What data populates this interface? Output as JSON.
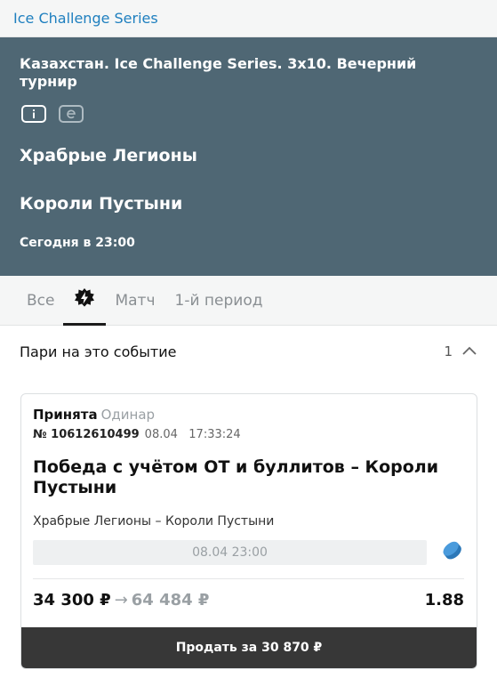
{
  "topbar": {
    "title": "Ice Challenge Series"
  },
  "event": {
    "tournament": "Казахстан. Ice Challenge Series. 3x10. Вечерний турнир",
    "team1": "Храбрые Легионы",
    "team2": "Короли Пустыни",
    "time": "Сегодня в 23:00",
    "icons": [
      "info-icon",
      "e-icon"
    ]
  },
  "tabs": [
    {
      "label": "Все",
      "active": false
    },
    {
      "icon": "flash-icon",
      "active": true
    },
    {
      "label": "Матч",
      "active": false
    },
    {
      "label": "1-й период",
      "active": false
    }
  ],
  "section": {
    "title": "Пари на это событие",
    "count": "1"
  },
  "bet": {
    "status": "Принята",
    "type": "Одинар",
    "number": "№ 10612610499",
    "datetime": "08.04   17:33:24",
    "title": "Победа с учётом ОТ и буллитов – Короли Пустыни",
    "teams": "Храбрые Легионы – Короли Пустыни",
    "event_time": "08.04 23:00",
    "stake": "34 300 ₽",
    "arrow": "→",
    "payout": "64 484 ₽",
    "coef": "1.88",
    "sell_label": "Продать за 30 870 ₽"
  },
  "colors": {
    "header_bg": "#4f6774",
    "link": "#1e7fbf",
    "puck": "#3a8ed0",
    "button_bg": "#373737"
  }
}
